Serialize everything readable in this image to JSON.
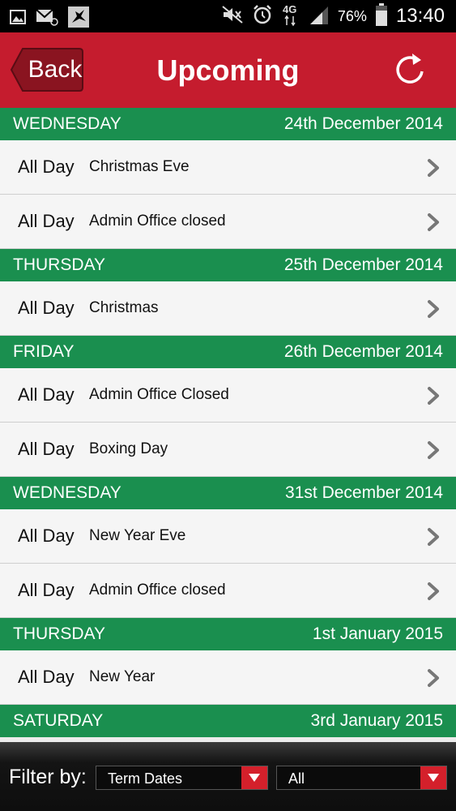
{
  "status_bar": {
    "battery": "76%",
    "network": "4G",
    "time": "13:40"
  },
  "header": {
    "back_label": "Back",
    "title": "Upcoming"
  },
  "days": [
    {
      "weekday": "WEDNESDAY",
      "date": "24th December 2014",
      "events": [
        {
          "time": "All Day",
          "title": "Christmas Eve"
        },
        {
          "time": "All Day",
          "title": "Admin Office closed"
        }
      ]
    },
    {
      "weekday": "THURSDAY",
      "date": "25th December 2014",
      "events": [
        {
          "time": "All Day",
          "title": "Christmas"
        }
      ]
    },
    {
      "weekday": "FRIDAY",
      "date": "26th December 2014",
      "events": [
        {
          "time": "All Day",
          "title": "Admin Office Closed"
        },
        {
          "time": "All Day",
          "title": "Boxing Day"
        }
      ]
    },
    {
      "weekday": "WEDNESDAY",
      "date": "31st December 2014",
      "events": [
        {
          "time": "All Day",
          "title": "New Year Eve"
        },
        {
          "time": "All Day",
          "title": "Admin Office closed"
        }
      ]
    },
    {
      "weekday": "THURSDAY",
      "date": "1st January 2015",
      "events": [
        {
          "time": "All Day",
          "title": "New Year"
        }
      ]
    },
    {
      "weekday": "SATURDAY",
      "date": "3rd January 2015",
      "events": []
    }
  ],
  "footer": {
    "filter_label": "Filter by:",
    "filter_type": "Term Dates",
    "filter_value": "All"
  }
}
